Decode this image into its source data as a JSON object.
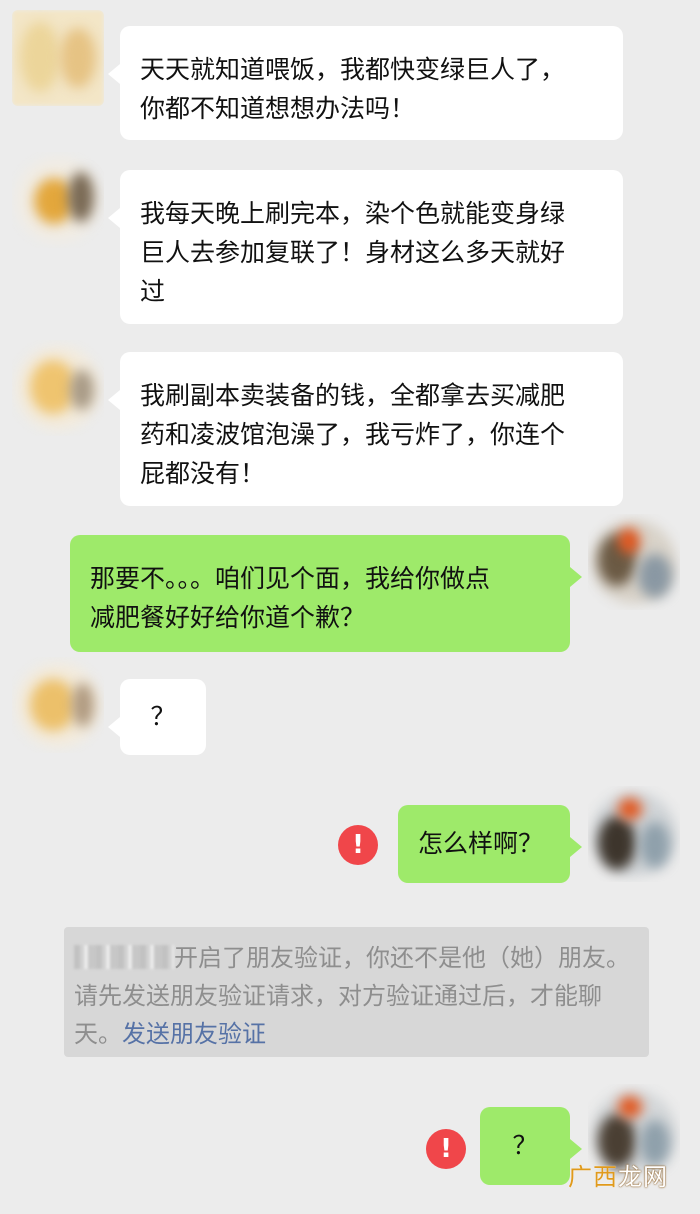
{
  "messages": [
    {
      "side": "in",
      "text": "天天就知道喂饭，我都快变绿巨人了，\n你都不知道想想办法吗！"
    },
    {
      "side": "in",
      "text": "我每天晚上刷完本，染个色就能变身绿\n巨人去参加复联了！身材这么多天就好\n过"
    },
    {
      "side": "in",
      "text": "我刷副本卖装备的钱，全都拿去买减肥\n药和凌波馆泡澡了，我亏炸了，你连个\n屁都没有！"
    },
    {
      "side": "out",
      "text": "那要不。。。咱们见个面，我给你做点\n减肥餐好好给你道个歉？"
    },
    {
      "side": "in",
      "text": "？"
    },
    {
      "side": "out",
      "text": "怎么样啊？",
      "failed": true
    },
    {
      "side": "out",
      "text": "？",
      "failed": true
    }
  ],
  "error_icon": "exclamation-circle-icon",
  "error_symbol": "!",
  "system_notice": {
    "text": "开启了朋友验证，你还不是他（她）朋友。请先发送朋友验证请求，对方验证通过后，才能聊天。",
    "link": "发送朋友验证"
  },
  "watermark": {
    "logo": "广西",
    "text": "龙网"
  },
  "colors": {
    "background": "#ececec",
    "incoming_bubble": "#ffffff",
    "outgoing_bubble": "#9eea6a",
    "error": "#f0464a",
    "notice_background": "#d7d7d7",
    "link": "#5672a6"
  }
}
